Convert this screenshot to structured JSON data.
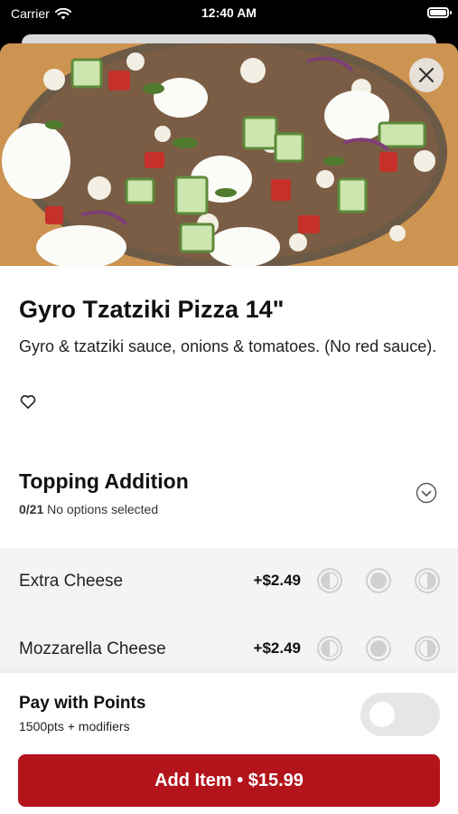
{
  "status_bar": {
    "carrier": "Carrier",
    "time": "12:40 AM"
  },
  "item": {
    "name": "Gyro Tzatziki Pizza 14\"",
    "description": "Gyro & tzatziki sauce, onions & tomatoes. (No red sauce).",
    "favorite_icon": "heart-outline-icon"
  },
  "topping_section": {
    "title": "Topping Addition",
    "selected_count": "0/21",
    "selected_text": "No options selected",
    "chevron_icon": "chevron-down-circle-icon",
    "options": [
      {
        "name": "Extra Cheese",
        "price": "+$2.49"
      },
      {
        "name": "Mozzarella Cheese",
        "price": "+$2.49"
      }
    ],
    "portion_icons": [
      "left-half-icon",
      "whole-icon",
      "right-half-icon"
    ]
  },
  "points": {
    "title": "Pay with Points",
    "subtitle": "1500pts + modifiers",
    "enabled": false
  },
  "add_button": {
    "label": "Add Item • $15.99"
  },
  "colors": {
    "accent": "#b3131b",
    "background": "#ffffff",
    "options_bg": "#f4f4f4"
  }
}
